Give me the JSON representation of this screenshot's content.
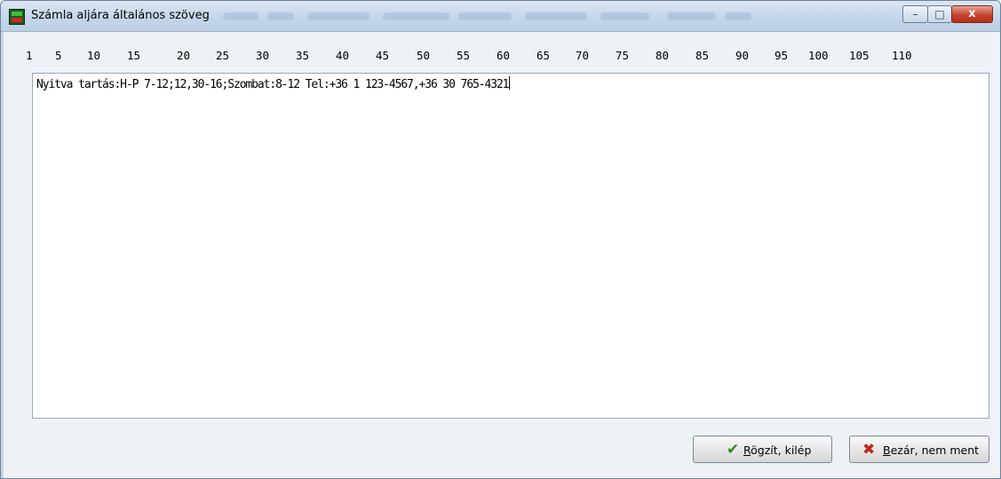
{
  "window": {
    "title": "Számla aljára általános szöveg",
    "controls": {
      "minimize": "–",
      "maximize": "□",
      "close": "x"
    }
  },
  "ruler": {
    "ticks": [
      "1",
      "5",
      "10",
      "15",
      "20",
      "25",
      "30",
      "35",
      "40",
      "45",
      "50",
      "55",
      "60",
      "65",
      "70",
      "75",
      "80",
      "85",
      "90",
      "95",
      "100",
      "105",
      "110"
    ]
  },
  "editor": {
    "text": "Nyitva tartás:H-P 7-12;12,30-16;Szombat:8-12 Tel:+36 1 123-4567,+36 30 765-4321"
  },
  "buttons": {
    "save": {
      "icon": "checkmark-icon",
      "accel": "R",
      "rest": "ögzít, kilép",
      "color": "#2e8b1e"
    },
    "cancel": {
      "icon": "red-x-icon",
      "accel": "B",
      "rest": "ezár, nem ment",
      "color": "#c3261a"
    }
  }
}
